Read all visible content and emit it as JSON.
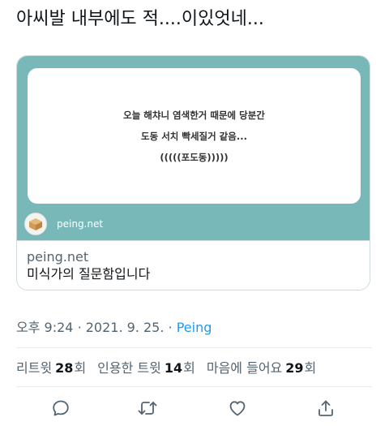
{
  "tweet": {
    "text": "아씨발 내부에도 적....이있엇네..."
  },
  "card": {
    "image_lines": [
      "오늘 해챠니 염색한거 때문에 당분간",
      "도동 서치 빡세질거 같음...",
      "(((((포도동)))))"
    ],
    "brand_name": "peing.net",
    "domain": "peing.net",
    "title": "미식가의 질문함입니다"
  },
  "meta": {
    "time": "오후 9:24",
    "date": "2021. 9. 25.",
    "separator": "·",
    "source": "Peing"
  },
  "stats": {
    "retweets_label": "리트윗",
    "retweets_count": "28",
    "retweets_unit": "회",
    "quotes_label": "인용한 트윗",
    "quotes_count": "14",
    "quotes_unit": "회",
    "likes_label": "마음에 들어요",
    "likes_count": "29",
    "likes_unit": "회"
  },
  "actions": [
    "reply-icon",
    "retweet-icon",
    "like-icon",
    "share-icon"
  ],
  "colors": {
    "card_background": "#79b8b8",
    "link": "#1d9bf0",
    "secondary_text": "#536471",
    "icon": "#536471"
  }
}
